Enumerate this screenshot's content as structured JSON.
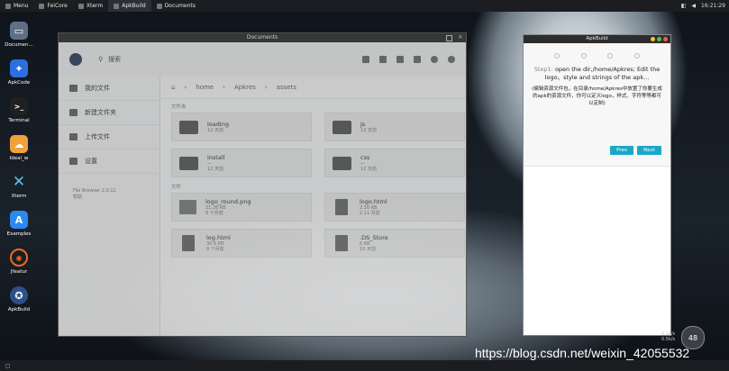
{
  "topbar": {
    "tasks": [
      {
        "label": "Menu"
      },
      {
        "label": "FeiCore"
      },
      {
        "label": "Xterm"
      },
      {
        "label": "ApkBuild"
      },
      {
        "label": "Documents"
      }
    ],
    "time": "16:21:29"
  },
  "dock": [
    {
      "label": "Documen...",
      "icon": "folder-icon",
      "color": "#5f6f86"
    },
    {
      "label": "ApkCode",
      "icon": "apkcode-icon",
      "color": "#2b6fe0"
    },
    {
      "label": "Terminal",
      "icon": "terminal-icon",
      "color": "#202020"
    },
    {
      "label": "Ideal_w",
      "icon": "ideal-icon",
      "color": "#f0a13b"
    },
    {
      "label": "Xterm",
      "icon": "x-icon",
      "color": "#1a87c5"
    },
    {
      "label": "Examples",
      "icon": "appstore-icon",
      "color": "#2b89f2"
    },
    {
      "label": "Jfeatur",
      "icon": "feature-icon",
      "color": "#ef6b1f"
    },
    {
      "label": "ApkBuild",
      "icon": "apkbuild-icon",
      "color": "#2d4f8a"
    }
  ],
  "docs": {
    "title": "Documents",
    "search_placeholder": "搜索",
    "sidebar": [
      {
        "label": "我的文件",
        "icon": "folder-icon"
      },
      {
        "label": "新建文件夹",
        "icon": "new-folder-icon"
      },
      {
        "label": "上传文件",
        "icon": "upload-icon"
      },
      {
        "label": "设置",
        "icon": "settings-icon"
      }
    ],
    "meta": [
      "File Browser 2.0.12",
      "帮助"
    ],
    "breadcrumb": [
      "home",
      "Apkres",
      "assets"
    ],
    "folders_label": "文件夹",
    "files_label": "文件",
    "folders": [
      {
        "name": "loading",
        "size": "",
        "time": "12 天前"
      },
      {
        "name": "js",
        "size": "",
        "time": "12 天前"
      },
      {
        "name": "install",
        "size": "—",
        "time": "12 天前"
      },
      {
        "name": "css",
        "size": "—",
        "time": "12 天前"
      }
    ],
    "files": [
      {
        "name": "logo_round.png",
        "size": "21.26 KB",
        "time": "9 个月前",
        "icon": "image-icon"
      },
      {
        "name": "logo.html",
        "size": "2.16 KB",
        "time": "2.11 月前",
        "icon": "document-icon"
      },
      {
        "name": "log.html",
        "size": "30.6 KB",
        "time": "9 个月前",
        "icon": "document-icon"
      },
      {
        "name": ".DS_Store",
        "size": "6 KB",
        "time": "10 天前",
        "icon": "document-icon"
      }
    ]
  },
  "apkbuild": {
    "title": "ApkBuild",
    "step_label": "Step1:",
    "step_text": "open the dir,/home/Apkres; Edit the logo、style and strings of the apk...",
    "zh_text": "(编辑资源文件包，在目录/home/Apkres中放置了你要生成的apk的资源文件，你可以定义logo，样式、字符等等都可以定制)",
    "prev_label": "Prev",
    "next_label": "Next"
  },
  "widget": {
    "badge": "48",
    "line1": "0.1k/s",
    "line2": "0.5k/s"
  },
  "watermark": "https://blog.csdn.net/weixin_42055532",
  "colors": {
    "accent": "#1aa8c7"
  }
}
